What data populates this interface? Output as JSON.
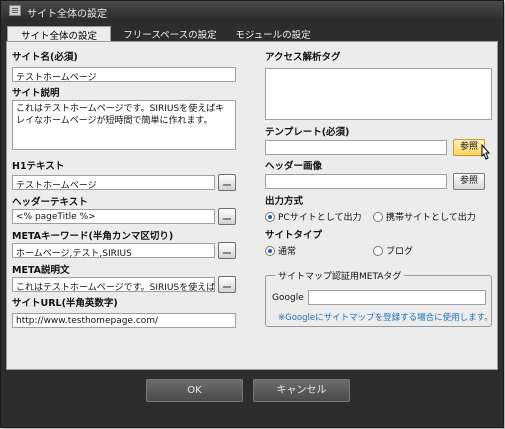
{
  "window": {
    "title": "サイト全体の設定"
  },
  "tabs": [
    {
      "label": "サイト全体の設定"
    },
    {
      "label": "フリースペースの設定"
    },
    {
      "label": "モジュールの設定"
    }
  ],
  "left": {
    "site_name": {
      "label": "サイト名(必須)",
      "value": "テストホームページ"
    },
    "site_desc": {
      "label": "サイト説明",
      "value": "これはテストホームページです。SIRIUSを使えばキレイなホームページが短時間で簡単に作れます。"
    },
    "h1_text": {
      "label": "H1テキスト",
      "value": "テストホームページ"
    },
    "header_text": {
      "label": "ヘッダーテキスト",
      "value": "<% pageTitle %>"
    },
    "meta_keywords": {
      "label": "METAキーワード(半角カンマ区切り)",
      "value": "ホームページ,テスト,SIRIUS"
    },
    "meta_desc": {
      "label": "META説明文",
      "value": "これはテストホームページです。SIRIUSを使えば4"
    },
    "site_url": {
      "label": "サイトURL(半角英数字)",
      "value": "http://www.testhomepage.com/"
    }
  },
  "right": {
    "access_tag": {
      "label": "アクセス解析タグ",
      "value": ""
    },
    "template": {
      "label": "テンプレート(必須)",
      "value": "",
      "button": "参照"
    },
    "header_image": {
      "label": "ヘッダー画像",
      "value": "",
      "button": "参照"
    },
    "output": {
      "label": "出力方式",
      "options": [
        {
          "label": "PCサイトとして出力",
          "selected": true
        },
        {
          "label": "携帯サイトとして出力",
          "selected": false
        }
      ]
    },
    "site_type": {
      "label": "サイトタイプ",
      "options": [
        {
          "label": "通常",
          "selected": true
        },
        {
          "label": "ブログ",
          "selected": false
        }
      ]
    },
    "sitemap_group": {
      "legend": "サイトマップ認証用METAタグ",
      "field_label": "Google",
      "value": "",
      "note": "※Googleにサイトマップを登録する場合に使用します。"
    }
  },
  "footer": {
    "ok": "OK",
    "cancel": "キャンセル"
  }
}
